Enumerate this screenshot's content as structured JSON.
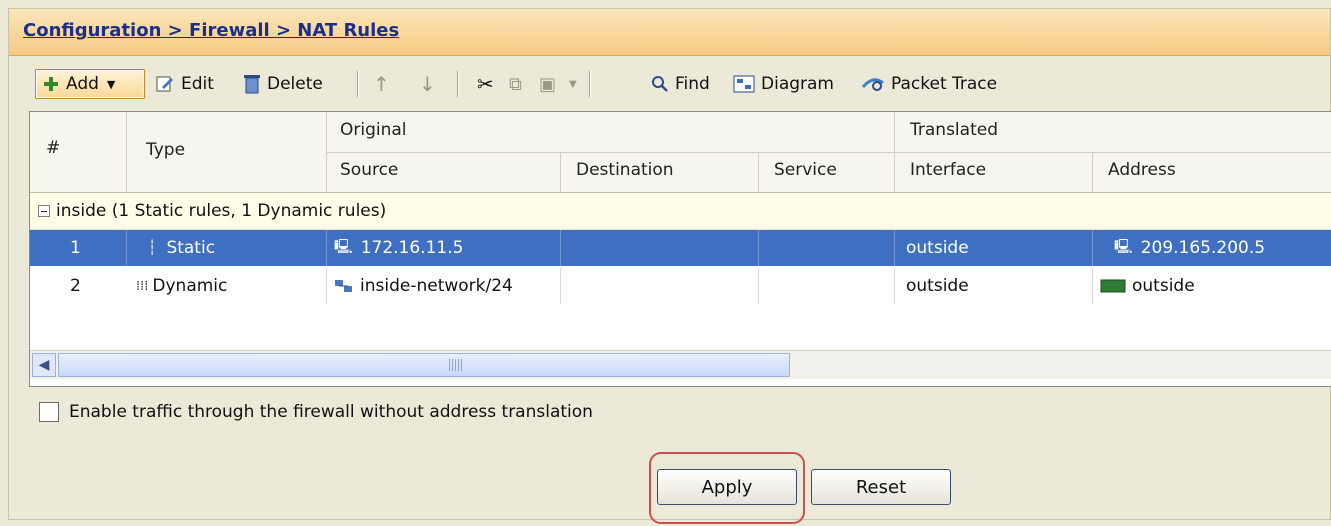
{
  "breadcrumb": "Configuration > Firewall > NAT Rules",
  "toolbar": {
    "add": "Add",
    "edit": "Edit",
    "delete": "Delete",
    "find": "Find",
    "diagram": "Diagram",
    "packet_trace": "Packet Trace"
  },
  "columns": {
    "num": "#",
    "type": "Type",
    "original": "Original",
    "translated": "Translated",
    "source": "Source",
    "destination": "Destination",
    "service": "Service",
    "interface": "Interface",
    "address": "Address"
  },
  "group": "inside (1 Static rules, 1 Dynamic rules)",
  "rows": [
    {
      "num": "1",
      "type": "Static",
      "source": "172.16.11.5",
      "destination": "",
      "service": "",
      "interface": "outside",
      "address": "209.165.200.5"
    },
    {
      "num": "2",
      "type": "Dynamic",
      "source": "inside-network/24",
      "destination": "",
      "service": "",
      "interface": "outside",
      "address": "outside"
    }
  ],
  "checkbox_label": "Enable traffic through the firewall without address translation",
  "buttons": {
    "apply": "Apply",
    "reset": "Reset"
  },
  "colors": {
    "selection": "#3f6fc0",
    "header": "#f6c980",
    "highlight": "#cc5050"
  }
}
